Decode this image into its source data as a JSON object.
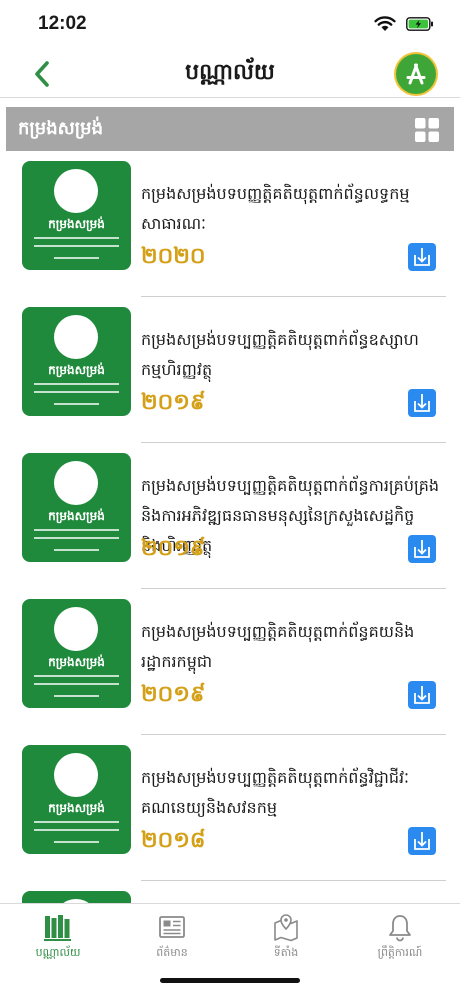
{
  "status_bar": {
    "time": "12:02"
  },
  "nav": {
    "title": "បណ្ណាល័យ"
  },
  "section": {
    "title": "កម្រងសម្រង់"
  },
  "books": [
    {
      "title": "កម្រងសម្រង់បទបញ្ញត្តិគតិយុត្តពាក់ព័ន្ធលទ្ធកម្មសាធារណៈ",
      "year": "២០២០"
    },
    {
      "title": "កម្រងសម្រង់បទប្បញ្ញត្តិគតិយុត្តពាក់ព័ន្ធឧស្សាហកម្មហិរញ្ញវត្ថុ",
      "year": "២០១៩"
    },
    {
      "title": "កម្រងសម្រង់បទប្បញ្ញត្តិគតិយុត្តពាក់ព័ន្ធការគ្រប់គ្រងនិងការអភិវឌ្ឍធនធានមនុស្សនៃក្រសួងសេដ្ឋកិច្ចនិងហិរញ្ញវត្ថុ",
      "year": "២០១៩"
    },
    {
      "title": "កម្រងសម្រង់បទប្បញ្ញត្តិគតិយុត្តពាក់ព័ន្ធគយនិងរដ្ឋាករកម្ពុជា",
      "year": "២០១៩"
    },
    {
      "title": "កម្រងសម្រង់បទប្បញ្ញត្តិគតិយុត្តពាក់ព័ន្ធវិជ្ជាជីវៈគណនេយ្យនិងសវនកម្ម",
      "year": "២០១៨"
    }
  ],
  "cover": {
    "title": "កម្រងសម្រង់",
    "color": "#1f8a3c"
  },
  "tabs": [
    {
      "label": "បណ្ណាល័យ",
      "icon": "library-icon",
      "active": true
    },
    {
      "label": "ព័ត៌មាន",
      "icon": "newspaper-icon",
      "active": false
    },
    {
      "label": "ទីតាំង",
      "icon": "location-map-icon",
      "active": false
    },
    {
      "label": "ព្រឹត្តិការណ៍",
      "icon": "bell-icon",
      "active": false
    }
  ],
  "colors": {
    "accent_green": "#2f8f45",
    "year_gold": "#d4a018",
    "download_blue": "#2a8af0",
    "section_gray": "#a6a6a6"
  }
}
